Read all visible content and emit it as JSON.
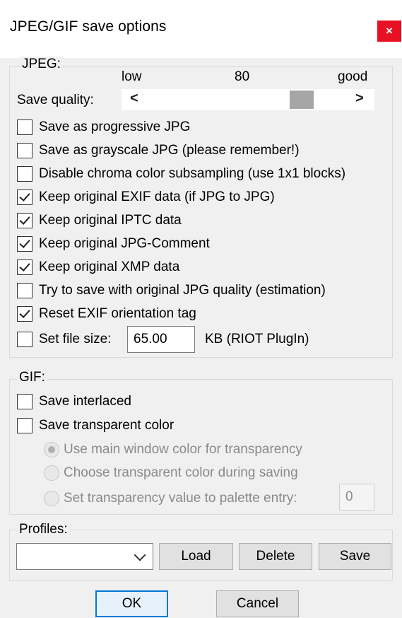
{
  "window": {
    "title": "JPEG/GIF save options",
    "close_glyph": "×"
  },
  "jpeg": {
    "group_label": "JPEG:",
    "quality": {
      "label": "Save quality:",
      "low_label": "low",
      "value_label": "80",
      "good_label": "good",
      "value": 80,
      "left_arrow": "<",
      "right_arrow": ">"
    },
    "options": [
      {
        "label": "Save as progressive JPG",
        "checked": false
      },
      {
        "label": "Save as grayscale JPG (please remember!)",
        "checked": false
      },
      {
        "label": "Disable chroma color subsampling (use 1x1 blocks)",
        "checked": false
      },
      {
        "label": "Keep original EXIF data (if JPG to JPG)",
        "checked": true
      },
      {
        "label": "Keep original IPTC data",
        "checked": true
      },
      {
        "label": "Keep original JPG-Comment",
        "checked": true
      },
      {
        "label": "Keep original XMP data",
        "checked": true
      },
      {
        "label": "Try to save with original JPG quality (estimation)",
        "checked": false
      },
      {
        "label": "Reset EXIF orientation tag",
        "checked": true
      }
    ],
    "file_size": {
      "label": "Set file size:",
      "checked": false,
      "value": "65.00",
      "unit_label": "KB (RIOT PlugIn)"
    }
  },
  "gif": {
    "group_label": "GIF:",
    "options": [
      {
        "label": "Save interlaced",
        "checked": false
      },
      {
        "label": "Save transparent color",
        "checked": false
      }
    ],
    "transparency": [
      {
        "label": "Use main window color for transparency",
        "selected": true
      },
      {
        "label": "Choose transparent color during saving",
        "selected": false
      },
      {
        "label": "Set transparency value to palette entry:",
        "selected": false
      }
    ],
    "palette_entry_value": "0"
  },
  "profiles": {
    "group_label": "Profiles:",
    "selected": "",
    "load_label": "Load",
    "delete_label": "Delete",
    "save_label": "Save"
  },
  "buttons": {
    "ok_label": "OK",
    "cancel_label": "Cancel"
  },
  "colors": {
    "close_bg": "#e81123",
    "default_button_border": "#0078d7",
    "dialog_bg": "#f0f0f0"
  }
}
